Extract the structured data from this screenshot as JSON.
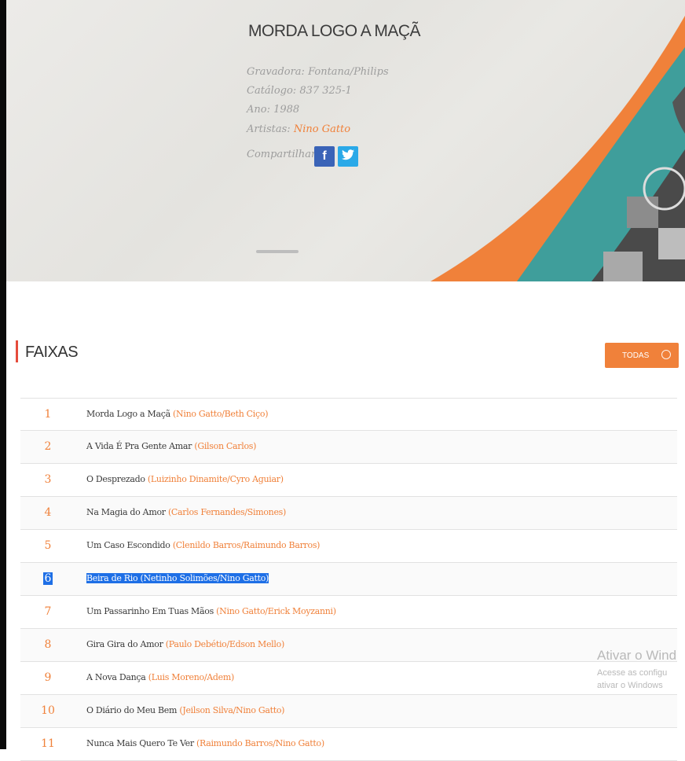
{
  "album": {
    "title": "MORDA LOGO A MAÇÃ",
    "gravadora_label": "Gravadora:",
    "gravadora": "Fontana/Philips",
    "catalogo_label": "Catálogo:",
    "catalogo": "837 325-1",
    "ano_label": "Ano:",
    "ano": "1988",
    "artistas_label": "Artistas:",
    "artistas": "Nino Gatto",
    "compartilhar_label": "Compartilhar:"
  },
  "share": {
    "facebook_glyph": "f",
    "twitter_glyph": "t"
  },
  "section": {
    "title": "FAIXAS",
    "button_label": "TODAS"
  },
  "tracks": [
    {
      "num": "1",
      "title": "Morda Logo a Maçã",
      "composers": "(Nino Gatto/Beth Ciço)"
    },
    {
      "num": "2",
      "title": "A Vida É Pra Gente Amar",
      "composers": "(Gilson Carlos)"
    },
    {
      "num": "3",
      "title": "O Desprezado",
      "composers": "(Luizinho Dinamite/Cyro Aguiar)"
    },
    {
      "num": "4",
      "title": "Na Magia do Amor",
      "composers": "(Carlos Fernandes/Simones)"
    },
    {
      "num": "5",
      "title": "Um Caso Escondido",
      "composers": "(Clenildo Barros/Raimundo Barros)"
    },
    {
      "num": "6",
      "title": "Beira de Rio",
      "composers": "(Netinho Solimões/Nino Gatto)"
    },
    {
      "num": "7",
      "title": "Um Passarinho Em Tuas Mãos",
      "composers": "(Nino Gatto/Erick Moyzanni)"
    },
    {
      "num": "8",
      "title": "Gira Gira do Amor",
      "composers": "(Paulo Debétio/Edson Mello)"
    },
    {
      "num": "9",
      "title": "A Nova Dança",
      "composers": "(Luis Moreno/Adem)"
    },
    {
      "num": "10",
      "title": "O Diário do Meu Bem",
      "composers": "(Jeilson Silva/Nino Gatto)"
    },
    {
      "num": "11",
      "title": "Nunca Mais Quero Te Ver",
      "composers": "(Raimundo Barros/Nino Gatto)"
    }
  ],
  "watermark": {
    "line1": "Ativar o Wind",
    "line2": "Acesse as configu",
    "line3": "ativar o Windows"
  },
  "colors": {
    "accent_orange": "#f0813a",
    "teal": "#3f9e9b",
    "selection_blue": "#1e6fe6",
    "faixas_bar_red": "#e54c3c"
  }
}
